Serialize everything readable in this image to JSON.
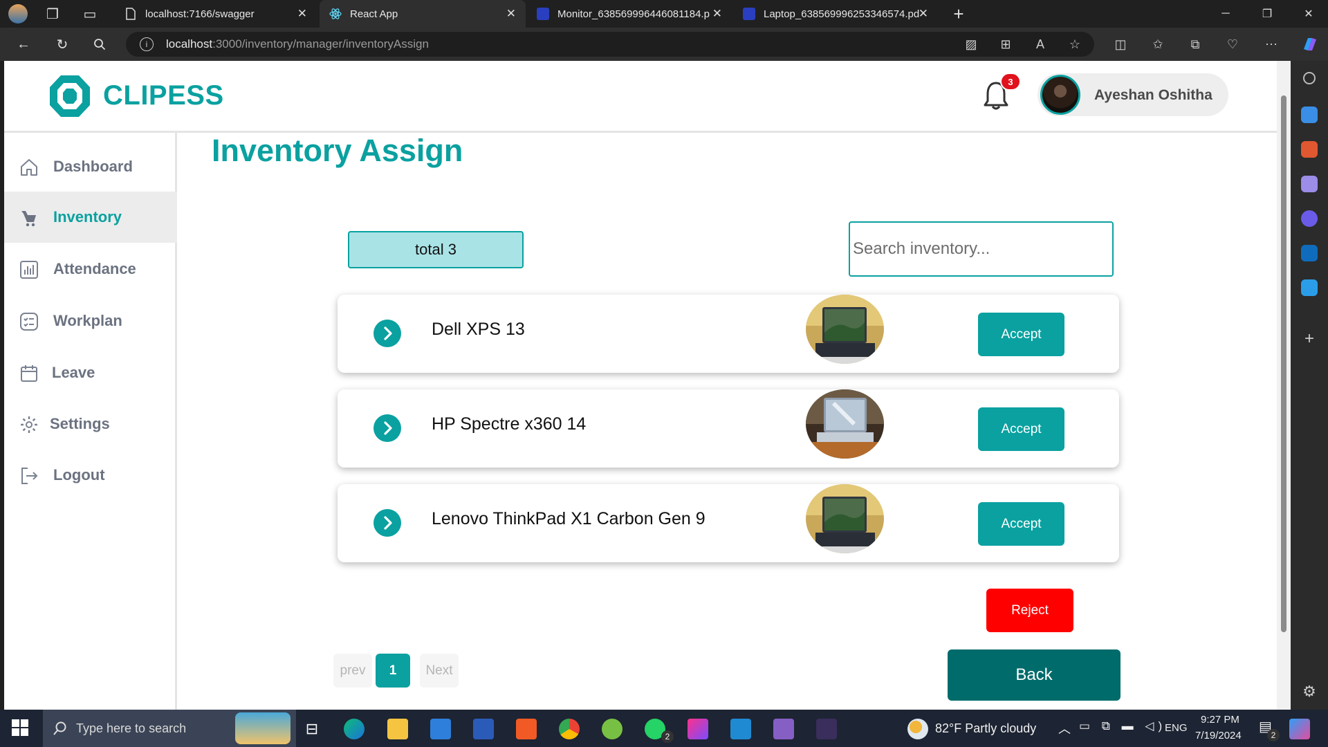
{
  "browser": {
    "tabs": [
      {
        "label": "localhost:7166/swagger",
        "icon": "page-icon"
      },
      {
        "label": "React App",
        "icon": "react-icon",
        "active": true
      },
      {
        "label": "Monitor_638569996446081184.p",
        "icon": "pdf-icon"
      },
      {
        "label": "Laptop_638569996253346574.pd",
        "icon": "pdf-icon"
      }
    ],
    "close_glyph": "✕",
    "new_tab_glyph": "+",
    "url_host": "localhost",
    "url_rest": ":3000/inventory/manager/inventoryAssign"
  },
  "header": {
    "brand": "CLIPESS",
    "notification_count": "3",
    "user_name": "Ayeshan Oshitha"
  },
  "sidebar": {
    "items": [
      {
        "label": "Dashboard",
        "icon": "home-icon"
      },
      {
        "label": "Inventory",
        "icon": "inventory-icon",
        "active": true
      },
      {
        "label": "Attendance",
        "icon": "bar-chart-icon"
      },
      {
        "label": "Workplan",
        "icon": "checklist-icon"
      },
      {
        "label": "Leave",
        "icon": "calendar-icon"
      },
      {
        "label": "Settings",
        "icon": "gear-icon"
      },
      {
        "label": "Logout",
        "icon": "logout-icon"
      }
    ]
  },
  "main": {
    "title": "Inventory Assign",
    "total_label": "total 3",
    "search_placeholder": "Search inventory...",
    "items": [
      {
        "name": "Dell XPS 13",
        "accept": "Accept"
      },
      {
        "name": "HP Spectre x360 14",
        "accept": "Accept"
      },
      {
        "name": "Lenovo ThinkPad X1 Carbon Gen 9",
        "accept": "Accept"
      }
    ],
    "reject_label": "Reject",
    "back_label": "Back",
    "pagination": {
      "prev": "prev",
      "current": "1",
      "next": "Next"
    }
  },
  "taskbar": {
    "search_placeholder": "Type here to search",
    "weather": "82°F  Partly cloudy",
    "language": "ENG",
    "time": "9:27 PM",
    "date": "7/19/2024",
    "whatsapp_badge": "2",
    "notification_badge": "2"
  },
  "colors": {
    "accent": "#0aa1a0",
    "reject": "#ff0000",
    "back": "#006b6b"
  }
}
